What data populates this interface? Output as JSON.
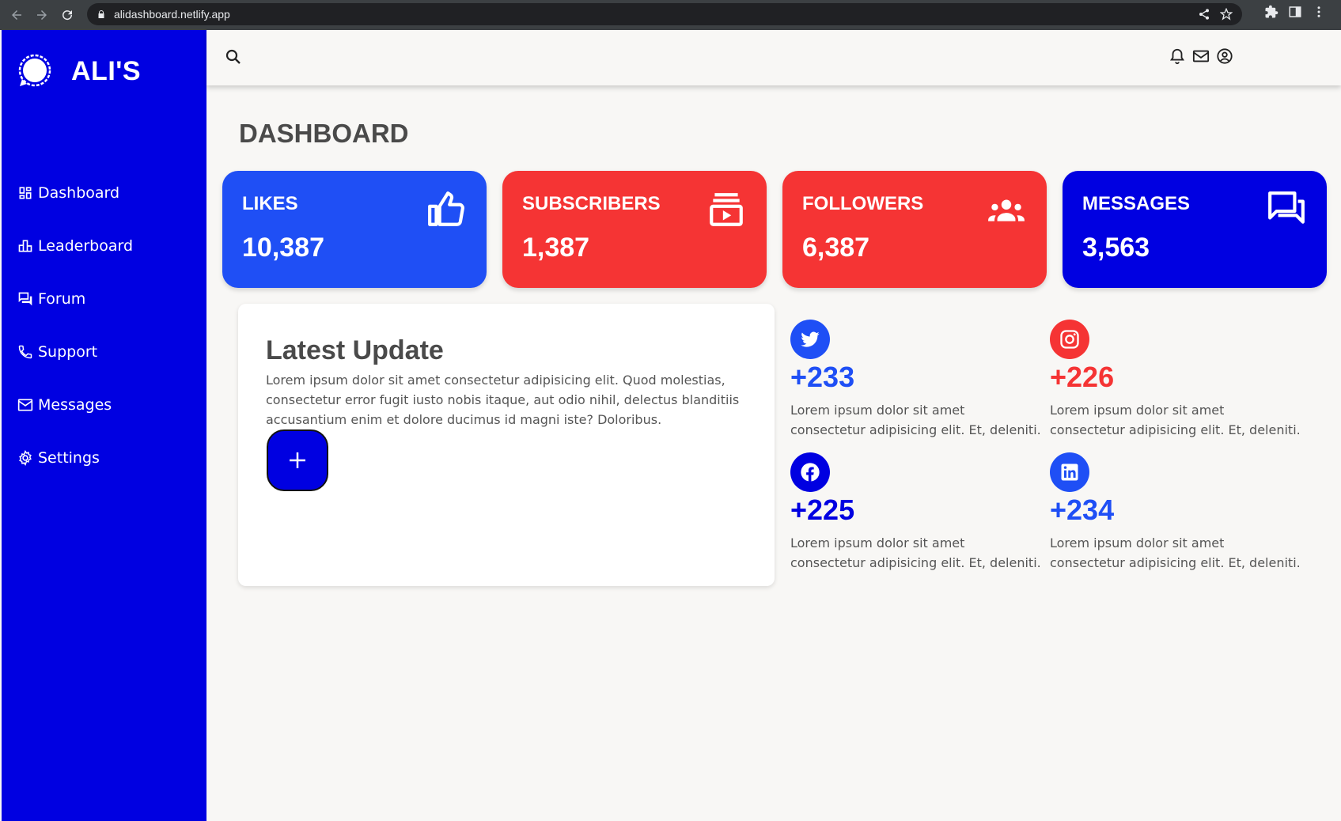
{
  "browser": {
    "url": "alidashboard.netlify.app"
  },
  "brand": {
    "name": "ALI'S"
  },
  "sidebar": {
    "items": [
      {
        "label": "Dashboard",
        "icon": "dashboard-icon"
      },
      {
        "label": "Leaderboard",
        "icon": "leaderboard-icon"
      },
      {
        "label": "Forum",
        "icon": "forum-icon"
      },
      {
        "label": "Support",
        "icon": "phone-icon"
      },
      {
        "label": "Messages",
        "icon": "mail-icon"
      },
      {
        "label": "Settings",
        "icon": "gear-icon"
      }
    ]
  },
  "main": {
    "title": "DASHBOARD",
    "cards": [
      {
        "label": "LIKES",
        "value": "10,387",
        "color": "#1f4ff5",
        "icon": "thumbs-up-icon"
      },
      {
        "label": "SUBSCRIBERS",
        "value": "1,387",
        "color": "#f53434",
        "icon": "subscriptions-icon"
      },
      {
        "label": "FOLLOWERS",
        "value": "6,387",
        "color": "#f53434",
        "icon": "group-icon"
      },
      {
        "label": "MESSAGES",
        "value": "3,563",
        "color": "#0000e1",
        "icon": "chat-icon"
      }
    ],
    "update": {
      "title": "Latest Update",
      "text": "Lorem ipsum dolor sit amet consectetur adipisicing elit. Quod molestias, consectetur error fugit iusto nobis itaque, aut odio nihil, delectus blanditiis accusantium enim et dolore ducimus id magni iste? Doloribus."
    },
    "social": [
      {
        "network": "twitter",
        "value": "+233",
        "color": "#1f4ff5",
        "text": "Lorem ipsum dolor sit amet consectetur adipisicing elit. Et, deleniti."
      },
      {
        "network": "instagram",
        "value": "+226",
        "color": "#f53434",
        "text": "Lorem ipsum dolor sit amet consectetur adipisicing elit. Et, deleniti."
      },
      {
        "network": "facebook",
        "value": "+225",
        "color": "#0000e1",
        "text": "Lorem ipsum dolor sit amet consectetur adipisicing elit. Et, deleniti."
      },
      {
        "network": "linkedin",
        "value": "+234",
        "color": "#1f4ff5",
        "text": "Lorem ipsum dolor sit amet consectetur adipisicing elit. Et, deleniti."
      }
    ]
  }
}
